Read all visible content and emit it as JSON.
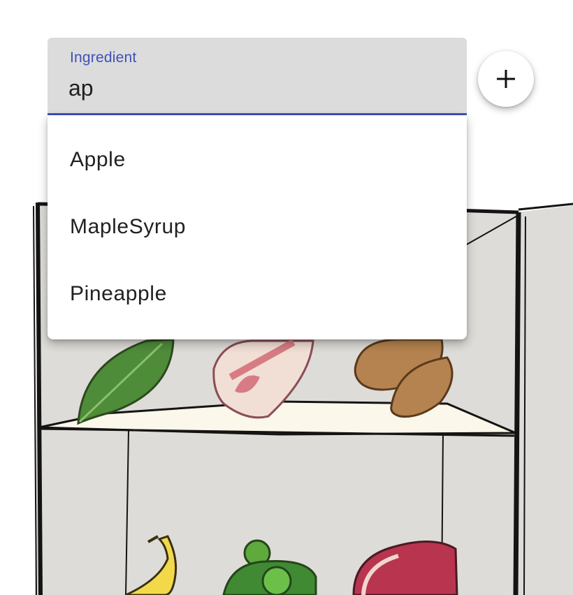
{
  "ingredient_field": {
    "label": "Ingredient",
    "value": "ap"
  },
  "dropdown": {
    "options": [
      "Apple",
      "MapleSyrup",
      "Pineapple"
    ]
  },
  "add_button": {
    "icon": "plus-icon"
  },
  "fridge": {
    "shelf_items": [
      "leaf-icon",
      "bacon-icon",
      "almond-icon",
      "banana-icon",
      "mint-icon",
      "steak-icon"
    ]
  }
}
